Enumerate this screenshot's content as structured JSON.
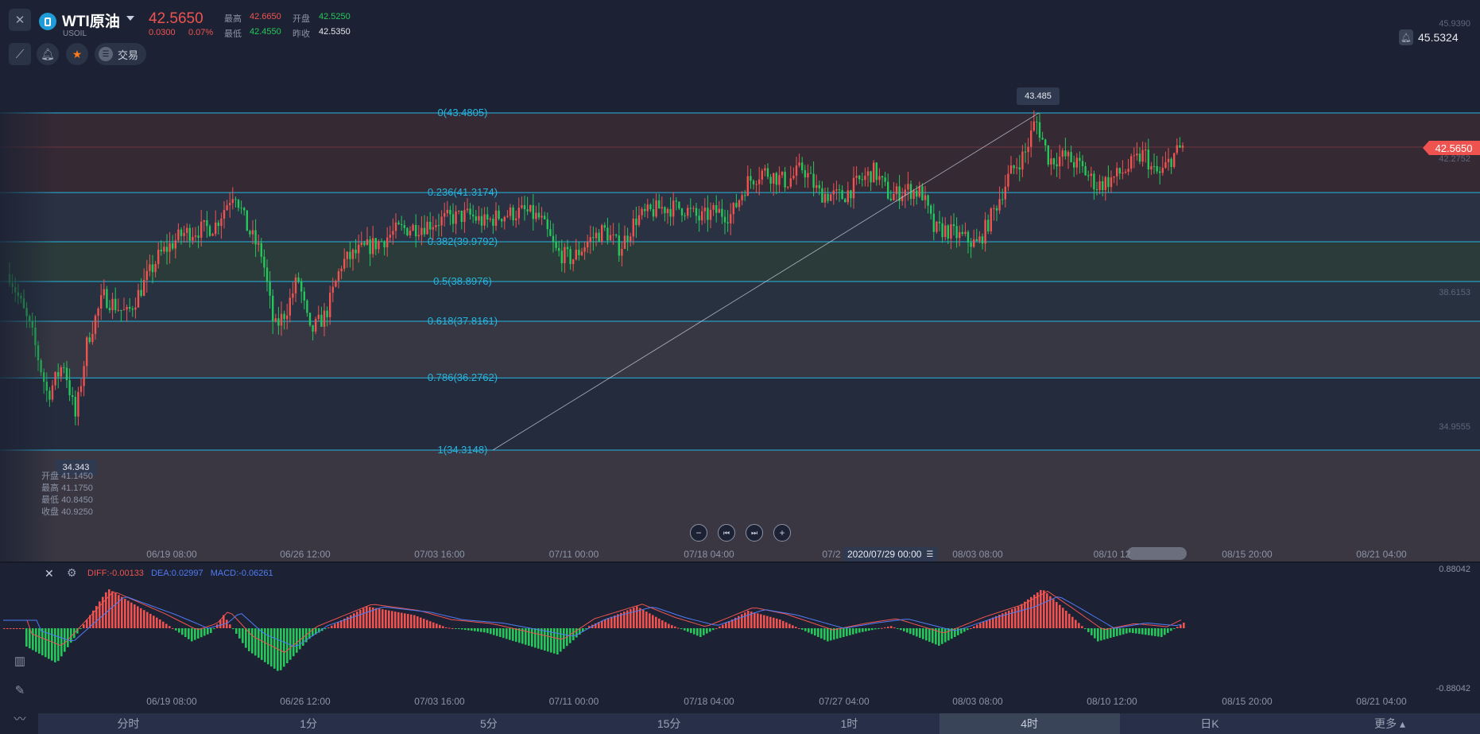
{
  "symbol": {
    "name": "WTI原油",
    "code": "USOIL",
    "price": "42.5650",
    "change": "0.0300",
    "change_pct": "0.07%"
  },
  "stats": {
    "high_label": "最高",
    "high": "42.6650",
    "open_label": "开盘",
    "open": "42.5250",
    "low_label": "最低",
    "low": "42.4550",
    "prev_close_label": "昨收",
    "prev_close": "42.5350"
  },
  "toolbar": {
    "trade_label": "交易"
  },
  "alert_price": "45.5324",
  "price_tag": "42.5650",
  "fib_levels": [
    {
      "label": "0(43.4805)",
      "value": 43.4805
    },
    {
      "label": "0.236(41.3174)",
      "value": 41.3174
    },
    {
      "label": "0.382(39.9792)",
      "value": 39.9792
    },
    {
      "label": "0.5(38.8976)",
      "value": 38.8976
    },
    {
      "label": "0.618(37.8161)",
      "value": 37.8161
    },
    {
      "label": "0.786(36.2762)",
      "value": 36.2762
    },
    {
      "label": "1(34.3148)",
      "value": 34.3148
    }
  ],
  "high_marker": "43.485",
  "low_marker": "34.343",
  "ohlc_tooltip": {
    "open_label": "开盘",
    "open": "41.1450",
    "high_label": "最高",
    "high": "41.1750",
    "low_label": "最低",
    "low": "40.8450",
    "close_label": "收盘",
    "close": "40.9250"
  },
  "right_axis": [
    "45.9390",
    "42.2752",
    "38.6153",
    "34.9555"
  ],
  "x_axis": [
    "06/19 08:00",
    "06/26 12:00",
    "07/03 16:00",
    "07/11 00:00",
    "07/18 04:00",
    "07/2",
    "08/03 08:00",
    "08/10 12",
    "08/15 20:00",
    "08/21 04:00"
  ],
  "crosshair_date": "2020/07/29 00:00",
  "macd": {
    "diff_label": "DIFF:",
    "diff": "-0.00133",
    "dea_label": "DEA:",
    "dea": "0.02997",
    "macd_label": "MACD:",
    "macd": "-0.06261",
    "axis_top": "0.88042",
    "axis_bottom": "-0.88042"
  },
  "x_axis_macd": [
    "06/19 08:00",
    "06/26 12:00",
    "07/03 16:00",
    "07/11 00:00",
    "07/18 04:00",
    "07/27 04:00",
    "08/03 08:00",
    "08/10 12:00",
    "08/15 20:00",
    "08/21 04:00"
  ],
  "timeframes": [
    "分时",
    "1分",
    "5分",
    "15分",
    "1时",
    "4时",
    "日K",
    "更多"
  ],
  "active_timeframe": "4时",
  "colors": {
    "up": "#ef5350",
    "down": "#26c75a",
    "fib": "#27b6e0",
    "diff": "#ef5350",
    "dea": "#4f7cf5"
  }
}
